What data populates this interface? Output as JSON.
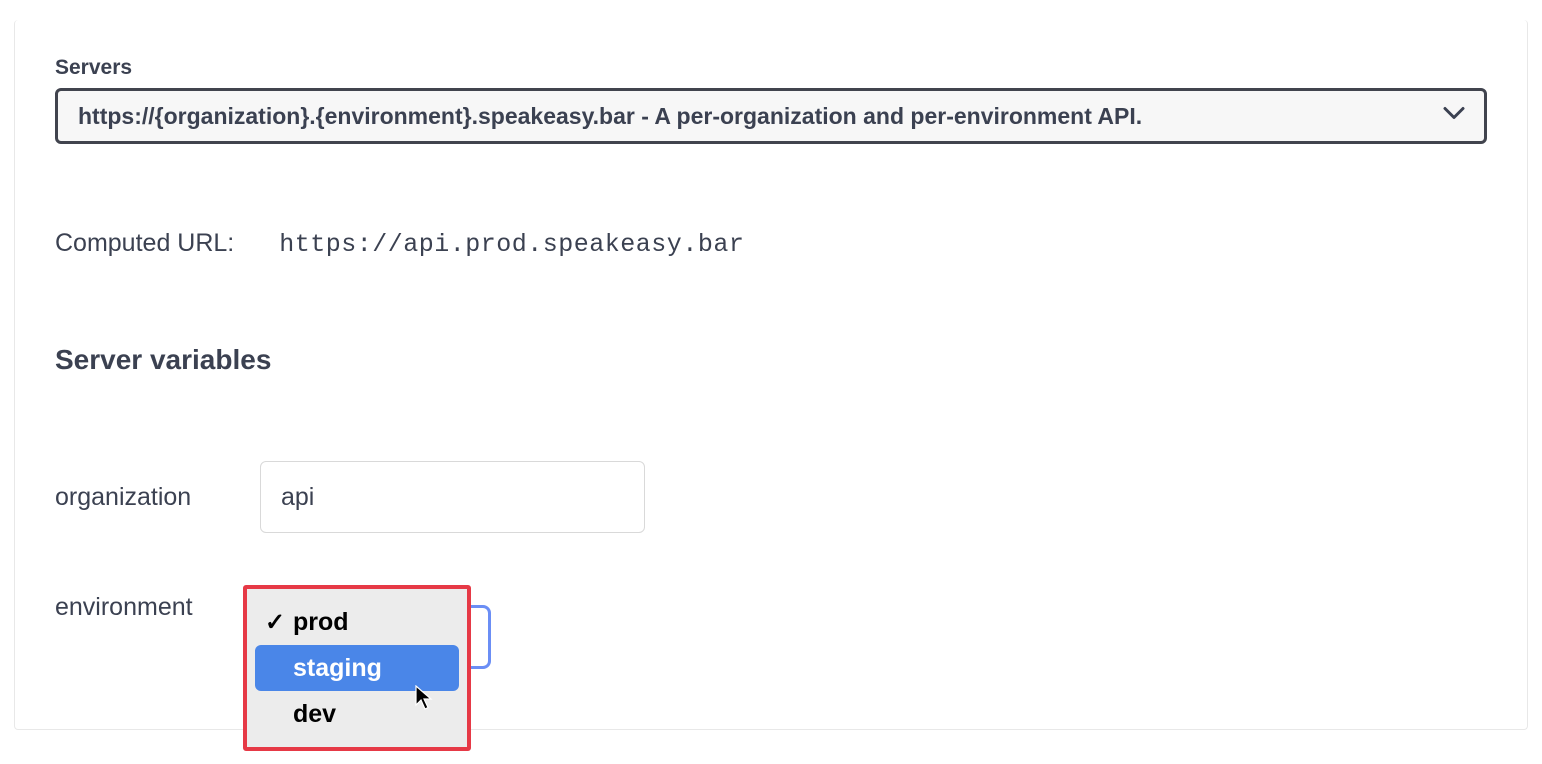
{
  "servers": {
    "label": "Servers",
    "selected": "https://{organization}.{environment}.speakeasy.bar - A per-organization and per-environment API."
  },
  "computed_url": {
    "label": "Computed URL:",
    "value": "https://api.prod.speakeasy.bar"
  },
  "server_variables": {
    "heading": "Server variables",
    "organization": {
      "label": "organization",
      "value": "api"
    },
    "environment": {
      "label": "environment",
      "selected": "prod",
      "options": [
        {
          "label": "prod",
          "selected": true,
          "highlighted": false
        },
        {
          "label": "staging",
          "selected": false,
          "highlighted": true
        },
        {
          "label": "dev",
          "selected": false,
          "highlighted": false
        }
      ]
    }
  }
}
